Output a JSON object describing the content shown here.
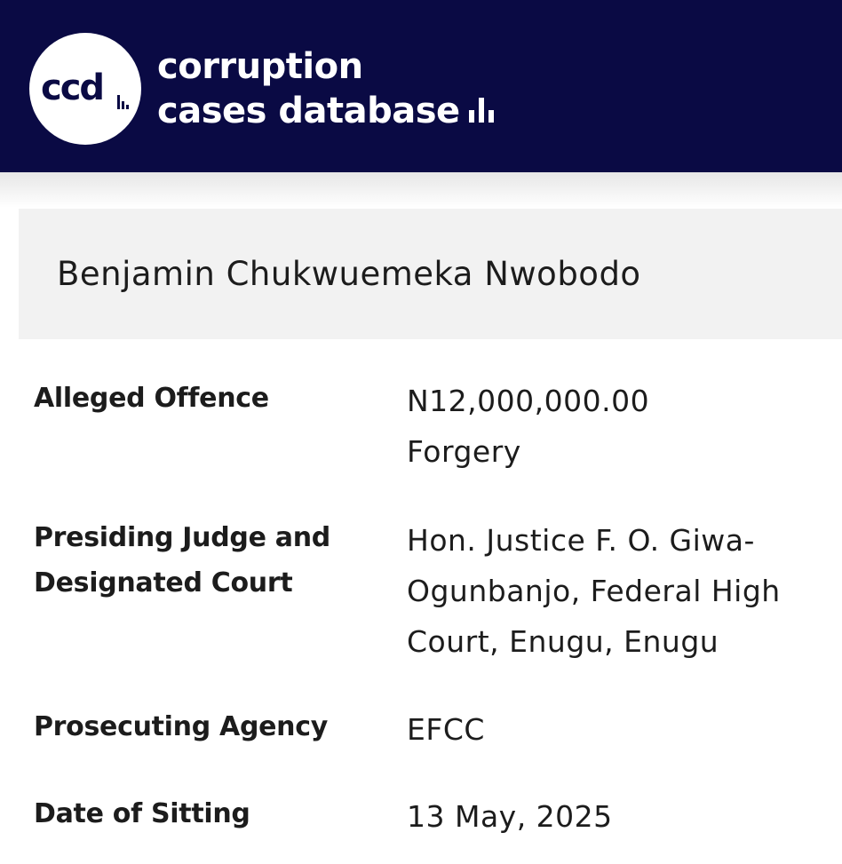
{
  "header": {
    "logo_text": "ccd",
    "brand_line1": "corruption",
    "brand_line2": "cases database",
    "background_color": "#0a0a44",
    "logo_icon": "bar-chart-icon"
  },
  "case": {
    "defendant_name": "Benjamin Chukwuemeka Nwobodo"
  },
  "details": {
    "alleged_offence": {
      "label": "Alleged Offence",
      "amount": "N12,000,000.00",
      "offence": "Forgery"
    },
    "judge_court": {
      "label_line1": "Presiding Judge and",
      "label_line2": "Designated Court",
      "value_line1": "Hon. Justice F. O. Giwa-",
      "value_line2": "Ogunbanjo, Federal High",
      "value_line3": "Court, Enugu, Enugu"
    },
    "prosecuting_agency": {
      "label": "Prosecuting Agency",
      "value": "EFCC"
    },
    "date_of_sitting": {
      "label": "Date of Sitting",
      "value": "13 May, 2025"
    }
  }
}
